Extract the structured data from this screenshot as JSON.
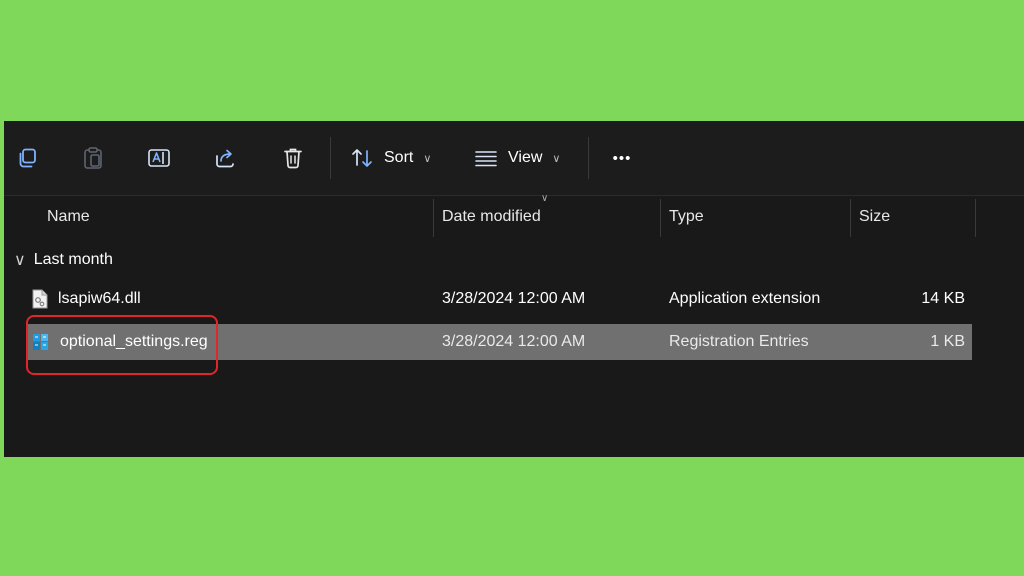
{
  "toolbar": {
    "sort_label": "Sort",
    "view_label": "View",
    "more_label": "•••",
    "icons": [
      "copy-icon",
      "paste-icon",
      "rename-icon",
      "share-icon",
      "delete-icon",
      "sort-icon",
      "view-icon",
      "more-icon"
    ]
  },
  "columns": {
    "name": "Name",
    "date_modified": "Date modified",
    "type": "Type",
    "size": "Size"
  },
  "group": {
    "label": "Last month"
  },
  "files": [
    {
      "name": "lsapiw64.dll",
      "date": "3/28/2024 12:00 AM",
      "type": "Application extension",
      "size": "14 KB",
      "icon": "dll-file-icon",
      "selected": false
    },
    {
      "name": "optional_settings.reg",
      "date": "3/28/2024 12:00 AM",
      "type": "Registration Entries",
      "size": "1 KB",
      "icon": "registry-file-icon",
      "selected": true
    }
  ],
  "colors": {
    "background": "#7fd85a",
    "window": "#191919",
    "selection": "#707070",
    "highlight_box": "#e0262a"
  }
}
